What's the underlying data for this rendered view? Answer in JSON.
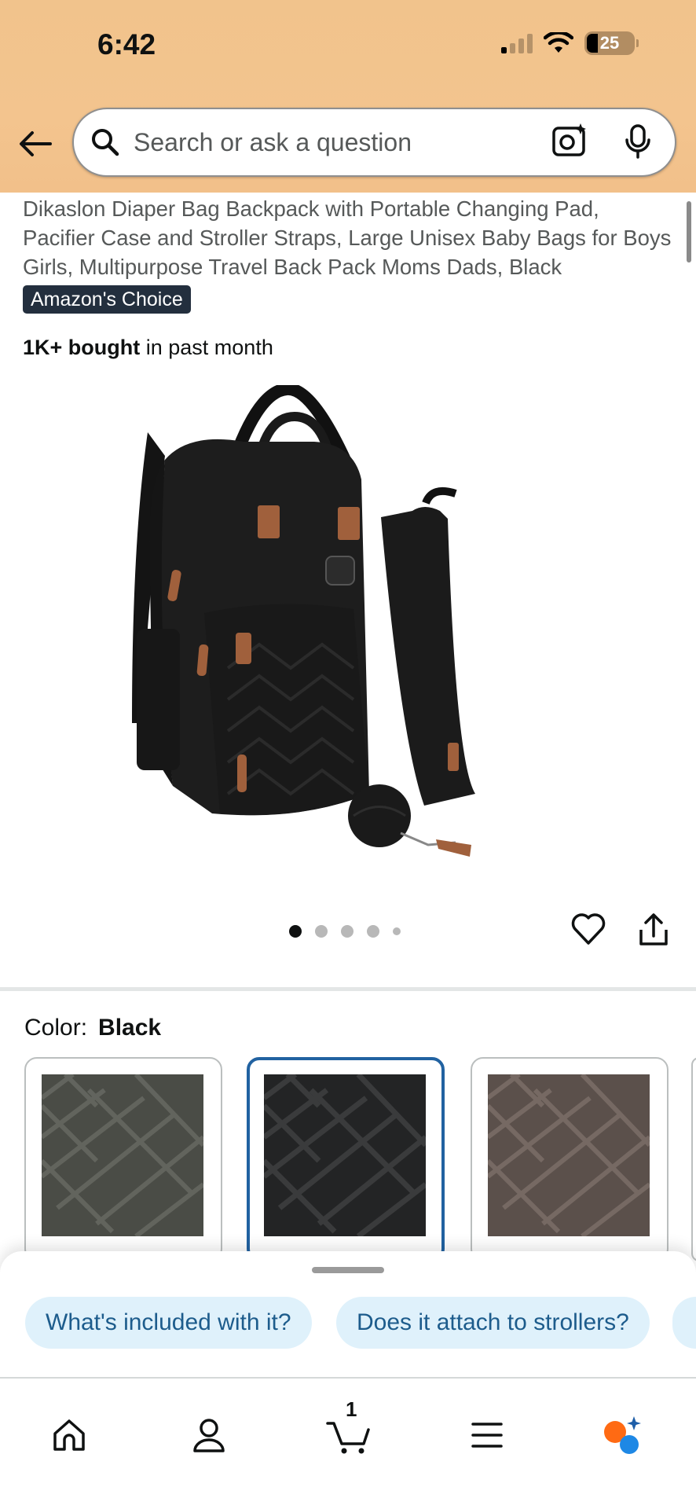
{
  "status_bar": {
    "time": "6:42",
    "battery": "25"
  },
  "search": {
    "placeholder": "Search or ask a question"
  },
  "product": {
    "title": "Dikaslon Diaper Bag Backpack with Portable Changing Pad, Pacifier Case and Stroller Straps, Large Unisex Baby Bags for Boys Girls, Multipurpose Travel Back Pack Moms Dads, Black",
    "badge": "Amazon's Choice",
    "bought_bold": "1K+ bought",
    "bought_rest": " in past month",
    "image_count": 5,
    "active_image_index": 0
  },
  "color": {
    "label": "Color:",
    "selected": "Black",
    "swatch_colors": [
      "#4a4c46",
      "#232425",
      "#5b504b"
    ]
  },
  "questions": [
    {
      "label": "What's included with it?"
    },
    {
      "label": "Does it attach to strollers?"
    }
  ],
  "nav": {
    "items": [
      "home-icon",
      "account-icon",
      "cart-icon",
      "menu-icon",
      "rufus-icon"
    ],
    "cart_count": "1"
  },
  "colors": {
    "header_bg": "#f2c28c",
    "badge_bg": "#232f3e",
    "selected_border": "#2162a1",
    "chip_bg": "#dff1fb",
    "chip_text": "#1d5c8c"
  }
}
